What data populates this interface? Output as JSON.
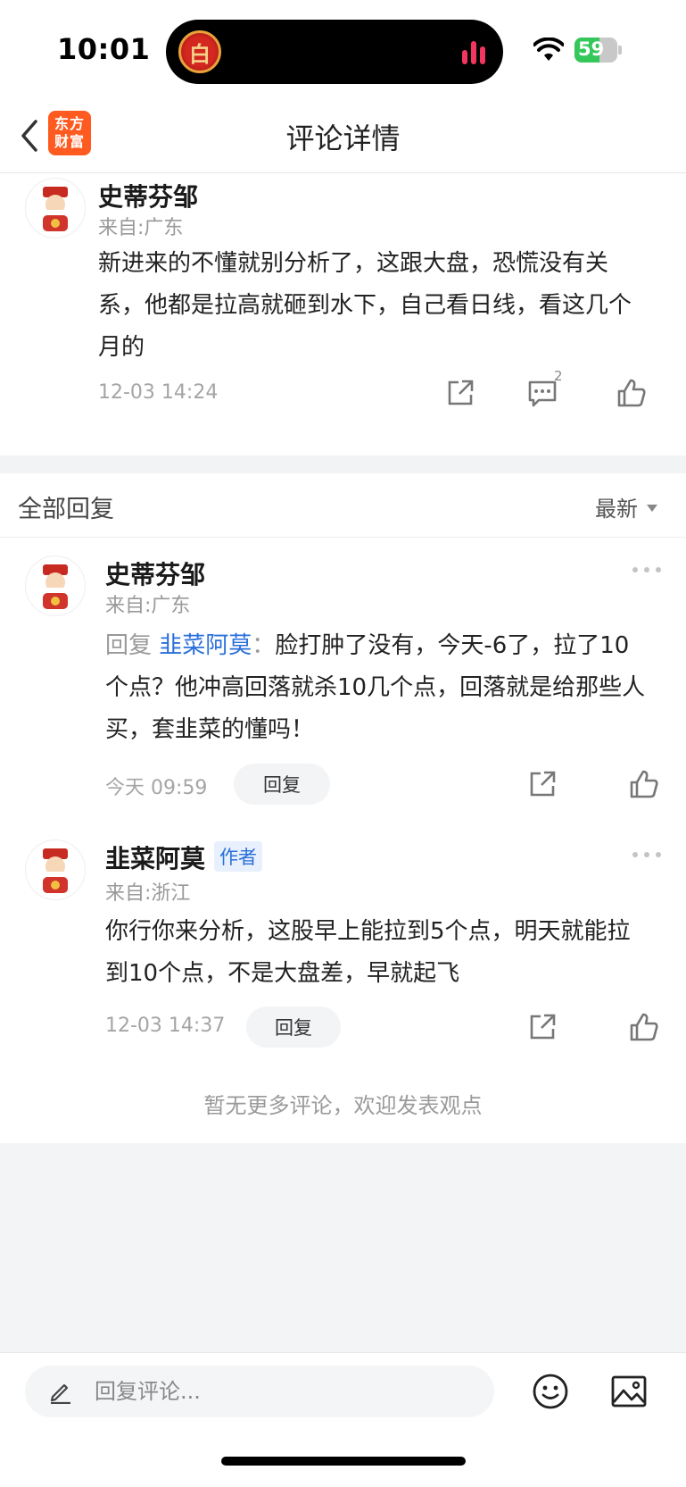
{
  "status_bar": {
    "time": "10:01",
    "battery": "59",
    "battery_level": 0.59,
    "island_app_glyph": "白",
    "wifi_icon": "wifi-icon",
    "colors": {
      "battery": "#34c759",
      "island_bars": "#f2365f"
    }
  },
  "nav": {
    "title": "评论详情",
    "logo_line1": "东方",
    "logo_line2": "财富",
    "back_icon": "chevron-left-icon",
    "brand_color": "#ff5a1f"
  },
  "main_comment": {
    "author": "史蒂芬邹",
    "location": "来自:广东",
    "text": "新进来的不懂就别分析了，这跟大盘，恐慌没有关系，他都是拉高就砸到水下，自己看日线，看这几个月的",
    "time": "12-03 14:24",
    "reply_count": "2"
  },
  "replies_section": {
    "title": "全部回复",
    "sort_label": "最新"
  },
  "replies": [
    {
      "author": "史蒂芬邹",
      "location": "来自:广东",
      "reply_prefix": "回复",
      "mention": "韭菜阿莫",
      "colon": "：",
      "text": "脸打肿了没有，今天-6了，拉了10个点？他冲高回落就杀10几个点，回落就是给那些人买，套韭菜的懂吗！",
      "time": "今天 09:59",
      "reply_button": "回复"
    },
    {
      "author": "韭菜阿莫",
      "badge": "作者",
      "location": "来自:浙江",
      "text": "你行你来分析，这股早上能拉到5个点，明天就能拉到10个点，不是大盘差，早就起飞",
      "time": "12-03 14:37",
      "reply_button": "回复"
    }
  ],
  "end_note": "暂无更多评论，欢迎发表观点",
  "input_bar": {
    "placeholder": "回复评论..."
  },
  "colors": {
    "link": "#2a6fdb",
    "badge_bg": "#e7f0fc",
    "muted": "#999999"
  }
}
